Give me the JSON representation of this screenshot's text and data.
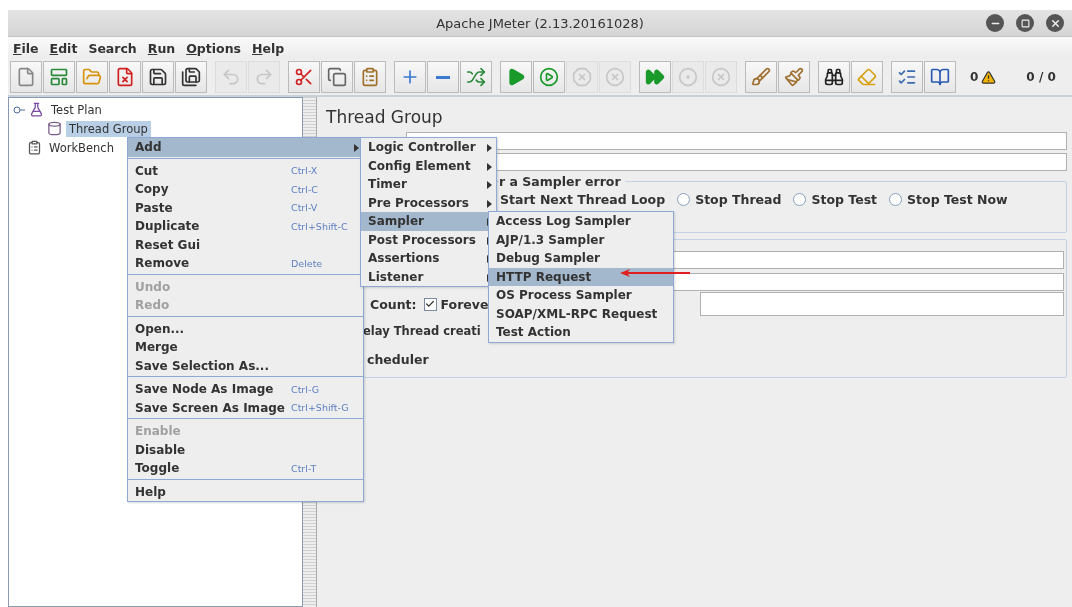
{
  "window": {
    "title": "Apache JMeter (2.13.20161028)"
  },
  "menu_bar": [
    {
      "label": "File",
      "underlined": true
    },
    {
      "label": "Edit",
      "underlined": true
    },
    {
      "label": "Search",
      "underlined": false
    },
    {
      "label": "Run",
      "underlined": true
    },
    {
      "label": "Options",
      "underlined": true
    },
    {
      "label": "Help",
      "underlined": true
    }
  ],
  "toolbar": {
    "groups": [
      [
        {
          "kind": "new",
          "disabled": false
        },
        {
          "kind": "templates",
          "disabled": false
        },
        {
          "kind": "open",
          "disabled": false
        },
        {
          "kind": "close",
          "disabled": false
        },
        {
          "kind": "save",
          "disabled": false
        },
        {
          "kind": "save-as",
          "disabled": false
        }
      ],
      [
        {
          "kind": "undo",
          "disabled": true
        },
        {
          "kind": "redo",
          "disabled": true
        }
      ],
      [
        {
          "kind": "cut",
          "disabled": false
        },
        {
          "kind": "copy",
          "disabled": false
        },
        {
          "kind": "paste",
          "disabled": false
        }
      ],
      [
        {
          "kind": "expand",
          "disabled": false
        },
        {
          "kind": "collapse",
          "disabled": false
        },
        {
          "kind": "toggle",
          "disabled": false
        }
      ],
      [
        {
          "kind": "start",
          "disabled": false
        },
        {
          "kind": "start-no-pauses",
          "disabled": false
        },
        {
          "kind": "stop",
          "disabled": true
        },
        {
          "kind": "shutdown",
          "disabled": true
        }
      ],
      [
        {
          "kind": "remote-start",
          "disabled": false
        },
        {
          "kind": "remote-stop",
          "disabled": true
        },
        {
          "kind": "remote-shutdown",
          "disabled": true
        }
      ],
      [
        {
          "kind": "clear",
          "disabled": false
        },
        {
          "kind": "clear-all",
          "disabled": false
        }
      ],
      [
        {
          "kind": "search",
          "disabled": false
        },
        {
          "kind": "reset-search",
          "disabled": false
        }
      ],
      [
        {
          "kind": "function-helper",
          "disabled": false
        },
        {
          "kind": "help",
          "disabled": false
        }
      ]
    ],
    "error_count": "0",
    "thread_count": "0 / 0"
  },
  "tree": [
    {
      "label": "Test Plan",
      "kind": "plan",
      "expanded": true,
      "selected": false,
      "children": [
        {
          "label": "Thread Group",
          "kind": "thread-group",
          "selected": true
        }
      ]
    },
    {
      "label": "WorkBench",
      "kind": "workbench",
      "selected": false
    }
  ],
  "context_menu": {
    "groups": [
      [
        {
          "label": "Add",
          "selected": true,
          "submenu": true,
          "disabled": false
        }
      ],
      [
        {
          "label": "Cut",
          "shortcut": "Ctrl-X",
          "selected": false,
          "disabled": false
        },
        {
          "label": "Copy",
          "shortcut": "Ctrl-C",
          "selected": false,
          "disabled": false
        },
        {
          "label": "Paste",
          "shortcut": "Ctrl-V",
          "selected": false,
          "disabled": false
        },
        {
          "label": "Duplicate",
          "shortcut": "Ctrl+Shift-C",
          "selected": false,
          "disabled": false
        },
        {
          "label": "Reset Gui",
          "selected": false,
          "disabled": false
        },
        {
          "label": "Remove",
          "shortcut": "Delete",
          "selected": false,
          "disabled": false
        }
      ],
      [
        {
          "label": "Undo",
          "selected": false,
          "disabled": true
        },
        {
          "label": "Redo",
          "selected": false,
          "disabled": true
        }
      ],
      [
        {
          "label": "Open...",
          "selected": false,
          "disabled": false
        },
        {
          "label": "Merge",
          "selected": false,
          "disabled": false
        },
        {
          "label": "Save Selection As...",
          "selected": false,
          "disabled": false
        }
      ],
      [
        {
          "label": "Save Node As Image",
          "shortcut": "Ctrl-G",
          "selected": false,
          "disabled": false
        },
        {
          "label": "Save Screen As Image",
          "shortcut": "Ctrl+Shift-G",
          "selected": false,
          "disabled": false
        }
      ],
      [
        {
          "label": "Enable",
          "selected": false,
          "disabled": true
        },
        {
          "label": "Disable",
          "selected": false,
          "disabled": false
        },
        {
          "label": "Toggle",
          "shortcut": "Ctrl-T",
          "selected": false,
          "disabled": false
        }
      ],
      [
        {
          "label": "Help",
          "selected": false,
          "disabled": false
        }
      ]
    ]
  },
  "add_submenu": [
    {
      "label": "Logic Controller",
      "selected": false,
      "submenu": true
    },
    {
      "label": "Config Element",
      "selected": false,
      "submenu": true
    },
    {
      "label": "Timer",
      "selected": false,
      "submenu": true
    },
    {
      "label": "Pre Processors",
      "selected": false,
      "submenu": true
    },
    {
      "label": "Sampler",
      "selected": true,
      "submenu": true
    },
    {
      "label": "Post Processors",
      "selected": false,
      "submenu": true
    },
    {
      "label": "Assertions",
      "selected": false,
      "submenu": true
    },
    {
      "label": "Listener",
      "selected": false,
      "submenu": true
    }
  ],
  "sampler_submenu": [
    {
      "label": "Access Log Sampler",
      "selected": false
    },
    {
      "label": "AJP/1.3 Sampler",
      "selected": false
    },
    {
      "label": "Debug Sampler",
      "selected": false
    },
    {
      "label": "HTTP Request",
      "selected": true
    },
    {
      "label": "OS Process Sampler",
      "selected": false
    },
    {
      "label": "SOAP/XML-RPC Request",
      "selected": false
    },
    {
      "label": "Test Action",
      "selected": false
    }
  ],
  "editor": {
    "title": "Thread Group",
    "error_group": {
      "legend": "r a Sampler error",
      "partial_option": "Start Next Thread Loop",
      "options": [
        {
          "label": "Stop Thread",
          "selected": false
        },
        {
          "label": "Stop Test",
          "selected": false
        },
        {
          "label": "Stop Test Now",
          "selected": false
        }
      ]
    },
    "properties": {
      "loop_label": "Count:",
      "forever": {
        "label": "Foreve",
        "checked": true
      },
      "delay_label": "elay Thread creati",
      "scheduler_label": "cheduler"
    }
  }
}
